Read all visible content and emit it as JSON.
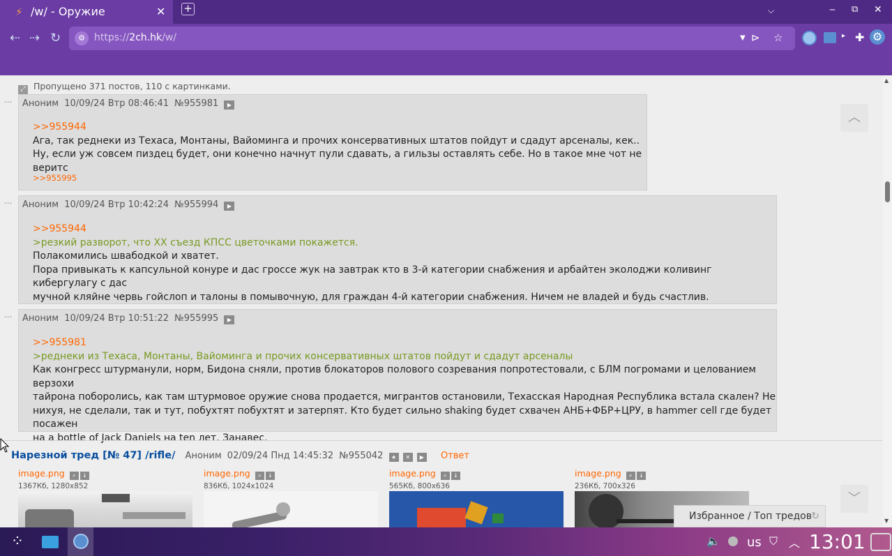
{
  "browser": {
    "tab_title": "/w/ - Оружие",
    "tab_close": "✕",
    "new_tab": "+",
    "url_prefix": "https://",
    "url_host": "2ch.hk",
    "url_path": "/w/"
  },
  "page": {
    "omitted_text": "Пропущено 371 постов, 110 с картинками.",
    "posts": [
      {
        "name": "Аноним",
        "date": "10/09/24 Втр 08:46:41",
        "num": "№955981",
        "lines": [
          {
            "type": "reply",
            "text": ">>955944"
          },
          {
            "type": "text",
            "text": "Ага, так реднеки из Техаса, Монтаны, Вайоминга и прочих консервативных штатов пойдут и сдадут арсеналы, кек.."
          },
          {
            "type": "text",
            "text": "Ну, если уж совсем пиздец будет, они конечно начнут пули сдавать, а гильзы оставлять себе. Но в такое мне чот не веритс"
          }
        ],
        "backlink": ">>955995"
      },
      {
        "name": "Аноним",
        "date": "10/09/24 Втр 10:42:24",
        "num": "№955994",
        "lines": [
          {
            "type": "reply",
            "text": ">>955944"
          },
          {
            "type": "quote",
            "text": ">резкий разворот, что ХХ съезд КПСС цветочками покажется."
          },
          {
            "type": "text",
            "text": "Полакомились швабодкой и хватет."
          },
          {
            "type": "text",
            "text": "Пора привыкать к капсульной конуре и дас гроссе жук на завтрак кто в 3-й категории снабжения и арбайтен эколоджи коливинг кибергулагу с дас"
          },
          {
            "type": "text",
            "text": "мучной кляйне червь гойслоп и талоны в помывочную, для граждан 4-й категории снабжения. Ничем не владей и будь счастлив."
          }
        ]
      },
      {
        "name": "Аноним",
        "date": "10/09/24 Втр 10:51:22",
        "num": "№955995",
        "lines": [
          {
            "type": "reply",
            "text": ">>955981"
          },
          {
            "type": "quote",
            "text": ">реднеки из Техаса, Монтаны, Вайоминга и прочих консервативных штатов пойдут и сдадут арсеналы"
          },
          {
            "type": "text",
            "text": "Как конгресс штурманули, норм, Бидона сняли, против блокаторов полового созревания попротестовали, с БЛМ погромами и целованием верзохи"
          },
          {
            "type": "text",
            "text": "тайрона поборолись, как там штурмовое оружие снова продается, мигрантов остановили, Техасская Народная Республика встала скален? Не"
          },
          {
            "type": "text",
            "text": "нихуя, не сделали, так и тут, побухтят побухтят и затерпят. Кто будет сильно shaking будет схвачен АНБ+ФБР+ЦРУ, в hammer cell где будет посажен"
          },
          {
            "type": "text",
            "text": "на a bottle of Jack Daniels на ten лет. Занавес."
          }
        ]
      }
    ],
    "thread": {
      "title": "Нарезной тред [№ 47] /rifle/",
      "name": "Аноним",
      "date": "02/09/24 Пнд 14:45:32",
      "num": "№955042",
      "answer": "Ответ",
      "images": [
        {
          "name": "image.png",
          "info": "1367Кб, 1280x852"
        },
        {
          "name": "image.png",
          "info": "836Кб, 1024x1024"
        },
        {
          "name": "image.png",
          "info": "565Кб, 800x636"
        },
        {
          "name": "image.png",
          "info": "236Кб, 700x326"
        }
      ]
    },
    "favorites_label": "Избранное / Топ тредов",
    "dots": "..."
  },
  "taskbar": {
    "keyboard_layout": "us",
    "clock": "13:01"
  },
  "colors": {
    "tabbar": "#4e2a84",
    "navbar": "#6a3ca4",
    "reply": "#ff6600",
    "quote": "#789922",
    "thread_title": "#0a4f9e"
  }
}
